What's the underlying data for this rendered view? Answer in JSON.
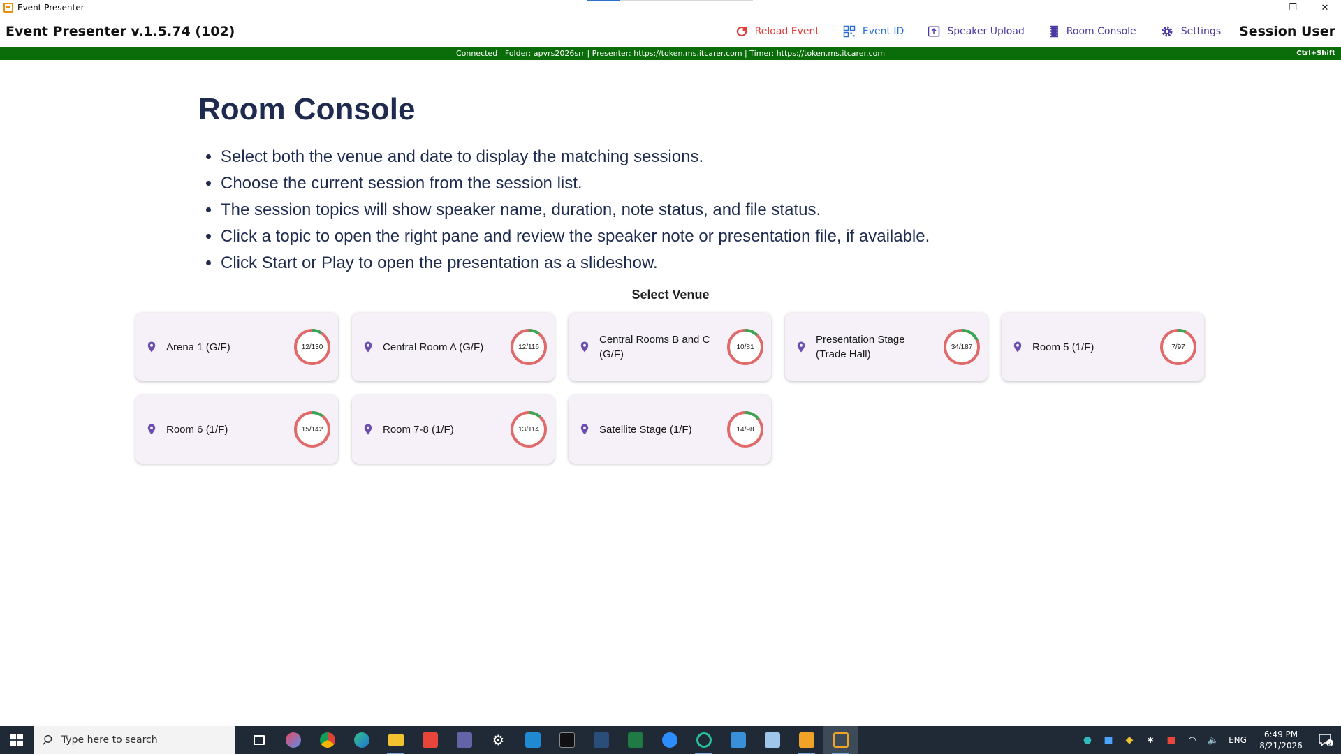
{
  "window": {
    "title": "Event Presenter",
    "minimize": "—",
    "restore": "❐",
    "close": "✕"
  },
  "header": {
    "app_name": "Event Presenter v.1.5.74 (102)",
    "nav": {
      "reload": "Reload Event",
      "event_id": "Event ID",
      "speaker_upload": "Speaker Upload",
      "room_console": "Room Console",
      "settings": "Settings",
      "user": "Session User"
    }
  },
  "status": {
    "text": "Connected | Folder: apvrs2026srr | Presenter: https://token.ms.itcarer.com | Timer: https://token.ms.itcarer.com",
    "shortcut": "Ctrl+Shift"
  },
  "main": {
    "title": "Room Console",
    "instructions": [
      "Select both the venue and date to display the matching sessions.",
      "Choose the current session from the session list.",
      "The session topics will show speaker name, duration, note status, and file status.",
      "Click a topic to open the right pane and review the speaker note or presentation file, if available.",
      "Click Start or Play to open the presentation as a slideshow."
    ],
    "venue_label": "Select Venue",
    "venues": [
      {
        "name": "Arena 1 (G/F)",
        "count": "12/130",
        "done": 12,
        "total": 130
      },
      {
        "name": "Central Room A (G/F)",
        "count": "12/116",
        "done": 12,
        "total": 116
      },
      {
        "name": "Central Rooms B and C (G/F)",
        "count": "10/81",
        "done": 10,
        "total": 81
      },
      {
        "name": "Presentation Stage (Trade Hall)",
        "count": "34/187",
        "done": 34,
        "total": 187
      },
      {
        "name": "Room 5 (1/F)",
        "count": "7/97",
        "done": 7,
        "total": 97
      },
      {
        "name": "Room 6 (1/F)",
        "count": "15/142",
        "done": 15,
        "total": 142
      },
      {
        "name": "Room 7-8 (1/F)",
        "count": "13/114",
        "done": 13,
        "total": 114
      },
      {
        "name": "Satellite Stage (1/F)",
        "count": "14/98",
        "done": 14,
        "total": 98
      }
    ]
  },
  "colors": {
    "status_bar": "#0a6d0a",
    "ring_done": "#3aa655",
    "ring_remaining": "#e06a6a",
    "pin": "#6a4fb0"
  },
  "taskbar": {
    "search_placeholder": "Type here to search",
    "language": "ENG",
    "time": "6:49 PM",
    "date": "8/21/2026",
    "notification_count": "2"
  }
}
